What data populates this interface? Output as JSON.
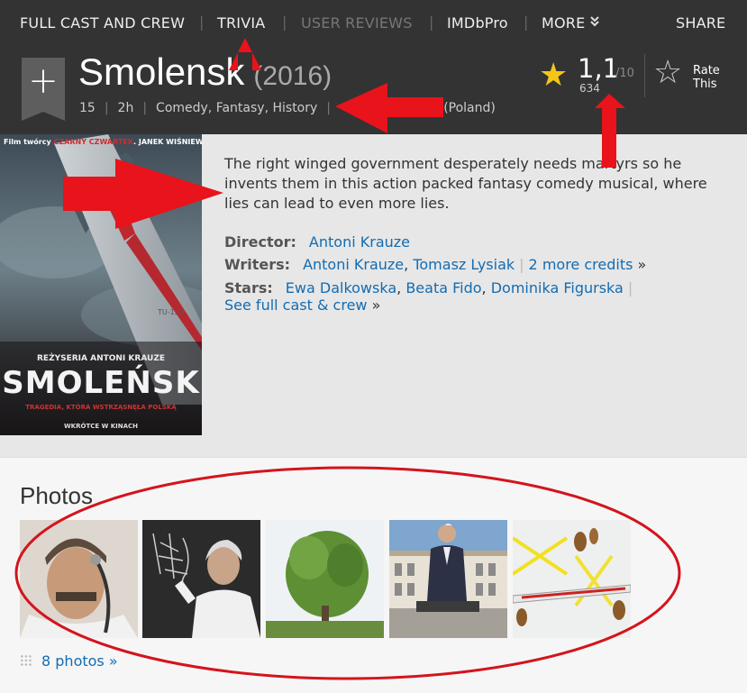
{
  "nav": {
    "items": [
      "FULL CAST AND CREW",
      "TRIVIA",
      "USER REVIEWS",
      "IMDbPro",
      "MORE"
    ],
    "share": "SHARE",
    "more_icon": "double-chevron-down-icon"
  },
  "title": {
    "add_label": "+",
    "name": "Smolensk",
    "year": "(2016)",
    "certificate": "15",
    "runtime": "2h",
    "genres": "Comedy, Fantasy, History",
    "release": "016 (Poland)"
  },
  "rating": {
    "value": "1,1",
    "max": "/10",
    "count": "634",
    "rate_label_1": "Rate",
    "rate_label_2": "This"
  },
  "poster": {
    "credit_prefix": "Film twórcy",
    "credit_red": "CZARNY CZWARTEK",
    "credit_suffix": ". JANEK WIŚNIEWSKI PADŁ",
    "director": "REŻYSERIA ANTONI KRAUZE",
    "title": "SMOLEŃSK",
    "tagline": "TRAGEDIA, KTÓRA WSTRZĄSNĘŁA POLSKĄ",
    "release": "WKRÓTCE W KINACH"
  },
  "summary": "The right winged government desperately needs martyrs so he invents them in this action packed fantasy comedy musical, where lies can lead to even more lies.",
  "credits": {
    "director_label": "Director:",
    "director": "Antoni Krauze",
    "writers_label": "Writers:",
    "writer1": "Antoni Krauze",
    "writer2": "Tomasz Lysiak",
    "writers_more": "2 more credits",
    "stars_label": "Stars:",
    "star1": "Ewa Dalkowska",
    "star2": "Beata Fido",
    "star3": "Dominika Figurska",
    "full_cast": "See full cast & crew",
    "raquo": "»",
    "comma": ","
  },
  "photos": {
    "title": "Photos",
    "link": "8 photos",
    "raquo": "»"
  },
  "colors": {
    "header_bg": "#333333",
    "link": "#136cb2",
    "star": "#f5c518",
    "annotation": "#e8131b"
  }
}
